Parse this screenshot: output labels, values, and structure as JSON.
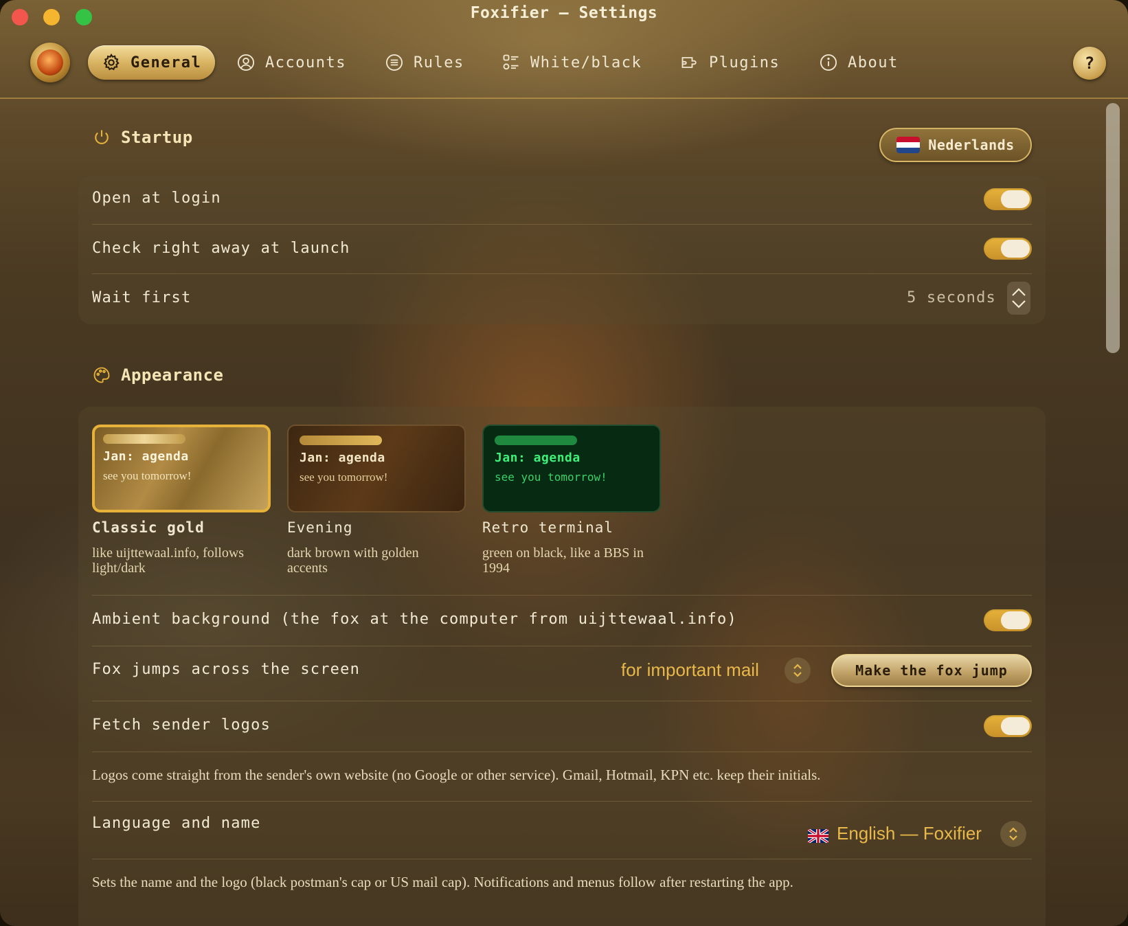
{
  "window": {
    "title": "Foxifier – Settings"
  },
  "tabs": [
    {
      "label": "General",
      "icon": "gear-icon",
      "active": true
    },
    {
      "label": "Accounts",
      "icon": "user-circle-icon",
      "active": false
    },
    {
      "label": "Rules",
      "icon": "list-circle-icon",
      "active": false
    },
    {
      "label": "White/black",
      "icon": "checklist-icon",
      "active": false
    },
    {
      "label": "Plugins",
      "icon": "plugin-icon",
      "active": false
    },
    {
      "label": "About",
      "icon": "info-icon",
      "active": false
    }
  ],
  "help": {
    "label": "?"
  },
  "startup": {
    "title": "Startup",
    "language_pill": "Nederlands",
    "rows": [
      {
        "label": "Open at login",
        "toggle": true
      },
      {
        "label": "Check right away at launch",
        "toggle": true
      },
      {
        "label": "Wait first",
        "value": "5 seconds"
      }
    ]
  },
  "appearance": {
    "title": "Appearance",
    "themes": [
      {
        "preview_title": "Jan: agenda",
        "preview_sub": "see you tomorrow!",
        "name": "Classic gold",
        "desc": "like uijttewaal.info, follows light/dark",
        "selected": true
      },
      {
        "preview_title": "Jan: agenda",
        "preview_sub": "see you tomorrow!",
        "name": "Evening",
        "desc": "dark brown with golden accents",
        "selected": false
      },
      {
        "preview_title": "Jan: agenda",
        "preview_sub": "see you tomorrow!",
        "name": "Retro terminal",
        "desc": "green on black, like a BBS in 1994",
        "selected": false
      }
    ],
    "ambient_label": "Ambient background (the fox at the computer from uijttewaal.info)",
    "ambient_toggle": true,
    "fox_jump_label": "Fox jumps across the screen",
    "fox_jump_value": "for important mail",
    "fox_jump_button": "Make the fox jump",
    "logos_label": "Fetch sender logos",
    "logos_toggle": true,
    "logos_note": "Logos come straight from the sender's own website (no Google or other service). Gmail, Hotmail, KPN etc. keep their initials.",
    "language_label": "Language and name",
    "language_value": "English — Foxifier",
    "language_note": "Sets the name and the logo (black postman's cap or US mail cap). Notifications and menus follow after restarting the app."
  },
  "colors": {
    "accent_gold": "#e6b23a",
    "terminal_green": "#3cf07a"
  }
}
